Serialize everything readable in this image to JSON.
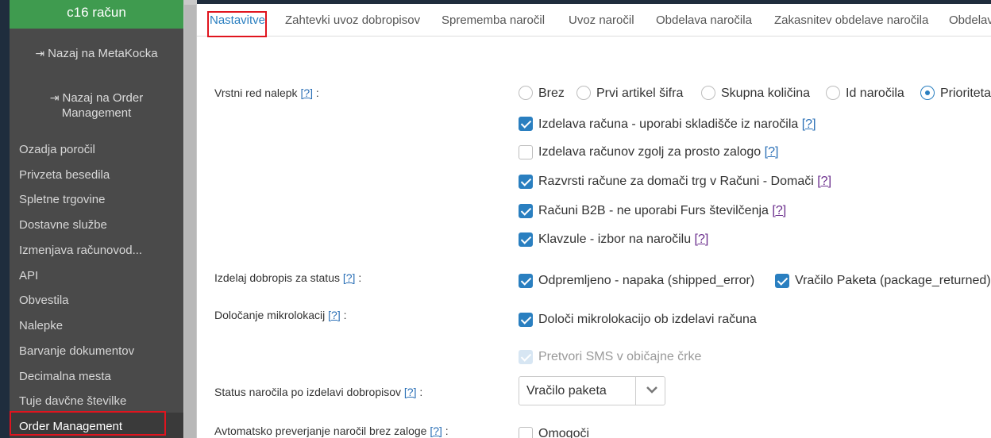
{
  "sidebar": {
    "title": "c16 račun",
    "back_links": [
      {
        "label": "Nazaj na MetaKocka"
      },
      {
        "label": "Nazaj na Order Management"
      }
    ],
    "items": [
      {
        "label": "Ozadja poročil"
      },
      {
        "label": "Privzeta besedila"
      },
      {
        "label": "Spletne trgovine"
      },
      {
        "label": "Dostavne službe"
      },
      {
        "label": "Izmenjava računovod..."
      },
      {
        "label": "API"
      },
      {
        "label": "Obvestila"
      },
      {
        "label": "Nalepke"
      },
      {
        "label": "Barvanje dokumentov"
      },
      {
        "label": "Decimalna mesta"
      },
      {
        "label": "Tuje davčne številke"
      },
      {
        "label": "Order Management"
      }
    ]
  },
  "tabs": [
    {
      "label": "Nastavitve"
    },
    {
      "label": "Zahtevki uvoz dobropisov"
    },
    {
      "label": "Sprememba naročil"
    },
    {
      "label": "Uvoz naročil"
    },
    {
      "label": "Obdelava naročila"
    },
    {
      "label": "Zakasnitev obdelave naročila"
    },
    {
      "label": "Obdelava"
    }
  ],
  "help_marker": "[?]",
  "colon": ":",
  "sections": {
    "label_order": {
      "label": "Vrstni red nalepk",
      "options": [
        "Brez",
        "Prvi artikel šifra",
        "Skupna količina",
        "Id naročila",
        "Prioriteta"
      ],
      "selected": "Prioriteta"
    },
    "checkboxes_main": [
      {
        "label": "Izdelava računa - uporabi skladišče iz naročila",
        "checked": true
      },
      {
        "label": "Izdelava računov zgolj za prosto zalogo",
        "checked": false
      },
      {
        "label": "Razvrsti račune za domači trg v Računi - Domači",
        "checked": true
      },
      {
        "label": "Računi B2B - ne uporabi Furs številčenja",
        "checked": true
      },
      {
        "label": "Klavzule - izbor na naročilu",
        "checked": true
      }
    ],
    "credit_note_status": {
      "label": "Izdelaj dobropis za status",
      "options": [
        {
          "label": "Odpremljeno - napaka (shipped_error)",
          "checked": true
        },
        {
          "label": "Vračilo Paketa (package_returned)",
          "checked": true
        }
      ]
    },
    "microlocation": {
      "label": "Določanje mikrolokacij",
      "options": [
        {
          "label": "Določi mikrolokacijo ob izdelavi računa",
          "checked": true
        },
        {
          "label": "Pretvori SMS v običajne črke",
          "checked": true,
          "disabled": true
        }
      ]
    },
    "order_status_after_credit": {
      "label": "Status naročila po izdelavi dobropisov",
      "value": "Vračilo paketa"
    },
    "auto_check": {
      "label": "Avtomatsko preverjanje naročil brez zaloge",
      "option": "Omogoči",
      "checked": false
    }
  },
  "colors": {
    "accent": "#2a7fc0",
    "highlight": "#e0141e",
    "sidebar_header": "#3f9b4f",
    "sidebar_bg": "#4a4a4a"
  }
}
